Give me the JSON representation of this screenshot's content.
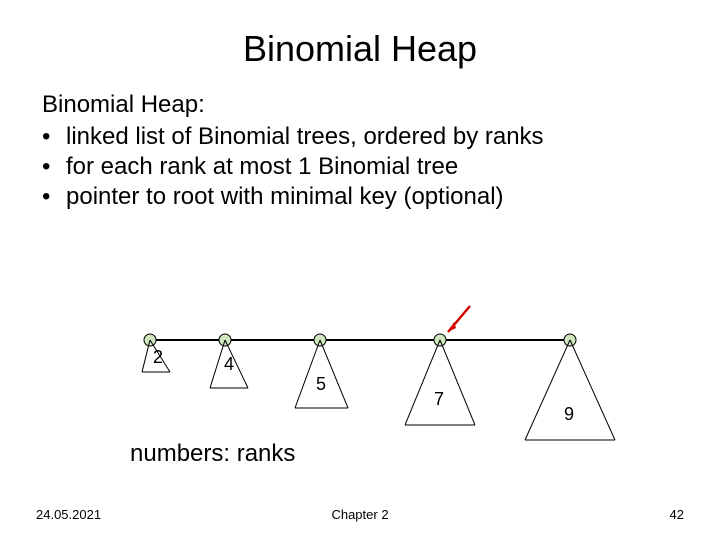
{
  "title": "Binomial Heap",
  "lead": "Binomial Heap:",
  "bullets": [
    "linked list of Binomial trees, ordered by ranks",
    "for each rank at most 1 Binomial tree",
    "pointer to root with minimal key (optional)"
  ],
  "diagram": {
    "labels": [
      "2",
      "4",
      "5",
      "7",
      "9"
    ],
    "caption": "numbers: ranks"
  },
  "footer": {
    "date": "24.05.2021",
    "chapter": "Chapter 2",
    "page": "42"
  }
}
